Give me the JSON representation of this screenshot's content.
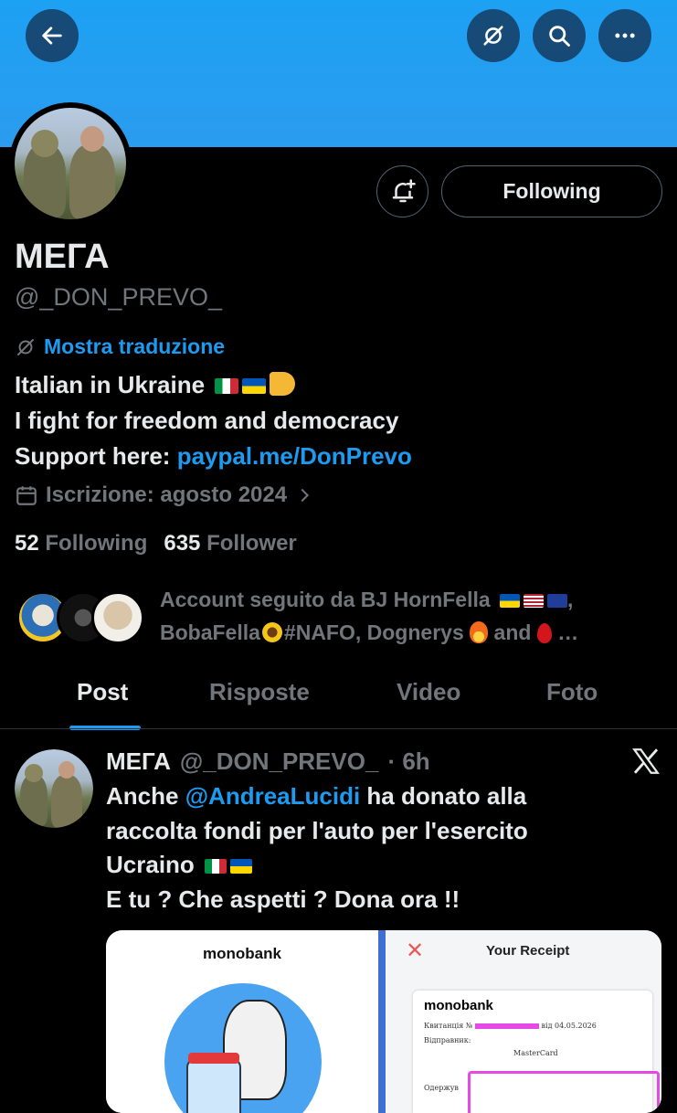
{
  "header": {
    "back_icon": "arrow-left-icon",
    "translate_icon": "translate-off-icon",
    "search_icon": "search-icon",
    "more_icon": "more-horizontal-icon",
    "banner_color": "#1da1f2"
  },
  "profile": {
    "name": "МЕГА",
    "handle": "@_DON_PREVO_",
    "notify_icon": "bell-plus-icon",
    "follow_label": "Following",
    "translate_label": "Mostra traduzione",
    "bio_line1": "Italian in Ukraine",
    "bio_line2": "I fight for freedom and democracy",
    "bio_line3_prefix": "Support here:",
    "bio_link": "paypal.me/DonPrevo",
    "joined": "Iscrizione: agosto 2024",
    "following_count": "52",
    "following_label": "Following",
    "followers_count": "635",
    "followers_label": "Follower",
    "followed_by_line1": "Account seguito da BJ HornFella",
    "followed_by_line2a": "BobaFella",
    "followed_by_line2b": "#NAFO, Dognerys",
    "followed_by_line2c": "and",
    "followed_by_ellipsis": "…"
  },
  "tabs": [
    {
      "label": "Post",
      "active": true
    },
    {
      "label": "Risposte",
      "active": false
    },
    {
      "label": "Video",
      "active": false
    },
    {
      "label": "Foto",
      "active": false
    }
  ],
  "post": {
    "author_name": "МЕГА",
    "author_handle": "@_DON_PREVO_",
    "time": "· 6h",
    "text_before": "Anche",
    "mention": "@AndreaLucidi",
    "text_line1_after": "ha donato alla",
    "text_line2": "raccolta fondi per l'auto per l'esercito",
    "text_line3": "Ucraino",
    "text_line4": "E tu ? Che aspetti ? Dona ora !!",
    "media_left_title": "monobank",
    "media_right_title": "Your Receipt",
    "receipt_brand": "monobank",
    "receipt_line1": "Квитанція №",
    "receipt_date": "від 04.05.2026",
    "receipt_line2": "Відправник:",
    "receipt_card": "MasterCard",
    "receipt_line3": "Одержув"
  },
  "colors": {
    "accent": "#1d9bf0",
    "muted": "#71767b",
    "text": "#e7e9ea",
    "background": "#000000"
  }
}
